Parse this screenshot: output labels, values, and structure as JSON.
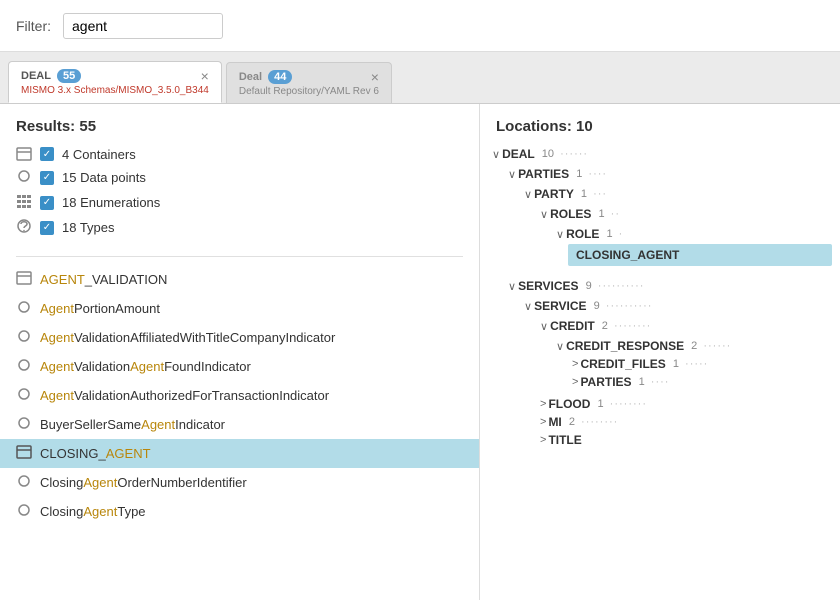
{
  "filter": {
    "label": "Filter:",
    "value": "agent"
  },
  "tabs": [
    {
      "id": "deal-tab-1",
      "schema_label": "DEAL",
      "badge": "55",
      "path": "MISMO 3.x Schemas/MISMO_3.5.0_B344",
      "path_class": "deal",
      "active": true
    },
    {
      "id": "deal-tab-2",
      "schema_label": "Deal",
      "badge": "44",
      "path": "Default Repository/YAML Rev 6",
      "path_class": "default",
      "active": false
    }
  ],
  "results": {
    "header": "Results: 55",
    "summary": [
      {
        "icon": "container-icon",
        "count": "4",
        "label": "Containers"
      },
      {
        "icon": "datapoint-icon",
        "count": "15",
        "label": "Data points"
      },
      {
        "icon": "enum-icon",
        "count": "18",
        "label": "Enumerations"
      },
      {
        "icon": "type-icon",
        "count": "18",
        "label": "Types"
      }
    ],
    "items": [
      {
        "icon": "container-icon",
        "text_parts": [
          {
            "text": "AGENT_VALIDATION",
            "highlight": false
          }
        ],
        "selected": false
      },
      {
        "icon": "datapoint-icon",
        "text_parts": [
          {
            "text": "Agent",
            "highlight": true
          },
          {
            "text": "PortionAmount",
            "highlight": false
          }
        ],
        "selected": false
      },
      {
        "icon": "datapoint-icon",
        "text_parts": [
          {
            "text": "Agent",
            "highlight": true
          },
          {
            "text": "ValidationAffiliatedWithTitleCompanyIndicator",
            "highlight": false
          }
        ],
        "selected": false
      },
      {
        "icon": "datapoint-icon",
        "text_parts": [
          {
            "text": "Agent",
            "highlight": true
          },
          {
            "text": "Validation",
            "highlight": false
          },
          {
            "text": "Agent",
            "highlight": true
          },
          {
            "text": "FoundIndicator",
            "highlight": false
          }
        ],
        "selected": false
      },
      {
        "icon": "datapoint-icon",
        "text_parts": [
          {
            "text": "Agent",
            "highlight": true
          },
          {
            "text": "ValidationAuthorizedForTransactionIndicator",
            "highlight": false
          }
        ],
        "selected": false
      },
      {
        "icon": "datapoint-icon",
        "text_parts": [
          {
            "text": "BuyerSellerSame",
            "highlight": false
          },
          {
            "text": "Agent",
            "highlight": true
          },
          {
            "text": "Indicator",
            "highlight": false
          }
        ],
        "selected": false
      },
      {
        "icon": "container-icon",
        "text_parts": [
          {
            "text": "CLOSING_AGENT",
            "highlight": false
          }
        ],
        "selected": true
      },
      {
        "icon": "datapoint-icon",
        "text_parts": [
          {
            "text": "Closing",
            "highlight": false
          },
          {
            "text": "Agent",
            "highlight": true
          },
          {
            "text": "OrderNumberIdentifier",
            "highlight": false
          }
        ],
        "selected": false
      },
      {
        "icon": "datapoint-icon",
        "text_parts": [
          {
            "text": "Closing",
            "highlight": false
          },
          {
            "text": "Agent",
            "highlight": true
          },
          {
            "text": "Type",
            "highlight": false
          }
        ],
        "selected": false
      }
    ]
  },
  "locations": {
    "header": "Locations: 10",
    "tree": [
      {
        "label": "DEAL",
        "count": "10",
        "dots": "······",
        "expanded": true,
        "indent": 0,
        "children": [
          {
            "label": "PARTIES",
            "count": "1",
            "dots": "····",
            "expanded": true,
            "indent": 1,
            "children": [
              {
                "label": "PARTY",
                "count": "1",
                "dots": "···",
                "expanded": true,
                "indent": 2,
                "children": [
                  {
                    "label": "ROLES",
                    "count": "1",
                    "dots": "··",
                    "expanded": true,
                    "indent": 3,
                    "children": [
                      {
                        "label": "ROLE",
                        "count": "1",
                        "dots": "·",
                        "expanded": true,
                        "indent": 4,
                        "children": [
                          {
                            "label": "CLOSING_AGENT",
                            "count": "",
                            "dots": "",
                            "expanded": false,
                            "indent": 5,
                            "highlighted": true,
                            "children": []
                          }
                        ]
                      }
                    ]
                  }
                ]
              }
            ]
          },
          {
            "label": "SERVICES",
            "count": "9",
            "dots": "··········",
            "expanded": true,
            "indent": 1,
            "children": [
              {
                "label": "SERVICE",
                "count": "9",
                "dots": "··········",
                "expanded": true,
                "indent": 2,
                "children": [
                  {
                    "label": "CREDIT",
                    "count": "2",
                    "dots": "········",
                    "expanded": true,
                    "indent": 3,
                    "children": [
                      {
                        "label": "CREDIT_RESPONSE",
                        "count": "2",
                        "dots": "······",
                        "expanded": true,
                        "indent": 4,
                        "children": [
                          {
                            "label": "CREDIT_FILES",
                            "count": "1",
                            "dots": "·····",
                            "expanded": false,
                            "indent": 5,
                            "children": []
                          },
                          {
                            "label": "PARTIES",
                            "count": "1",
                            "dots": "····",
                            "expanded": false,
                            "indent": 5,
                            "children": []
                          }
                        ]
                      }
                    ]
                  },
                  {
                    "label": "FLOOD",
                    "count": "1",
                    "dots": "········",
                    "expanded": false,
                    "indent": 3,
                    "children": []
                  },
                  {
                    "label": "MI",
                    "count": "2",
                    "dots": "········",
                    "expanded": false,
                    "indent": 3,
                    "children": []
                  },
                  {
                    "label": "TITLE",
                    "count": "",
                    "dots": "",
                    "expanded": false,
                    "indent": 3,
                    "children": []
                  }
                ]
              }
            ]
          }
        ]
      }
    ]
  }
}
